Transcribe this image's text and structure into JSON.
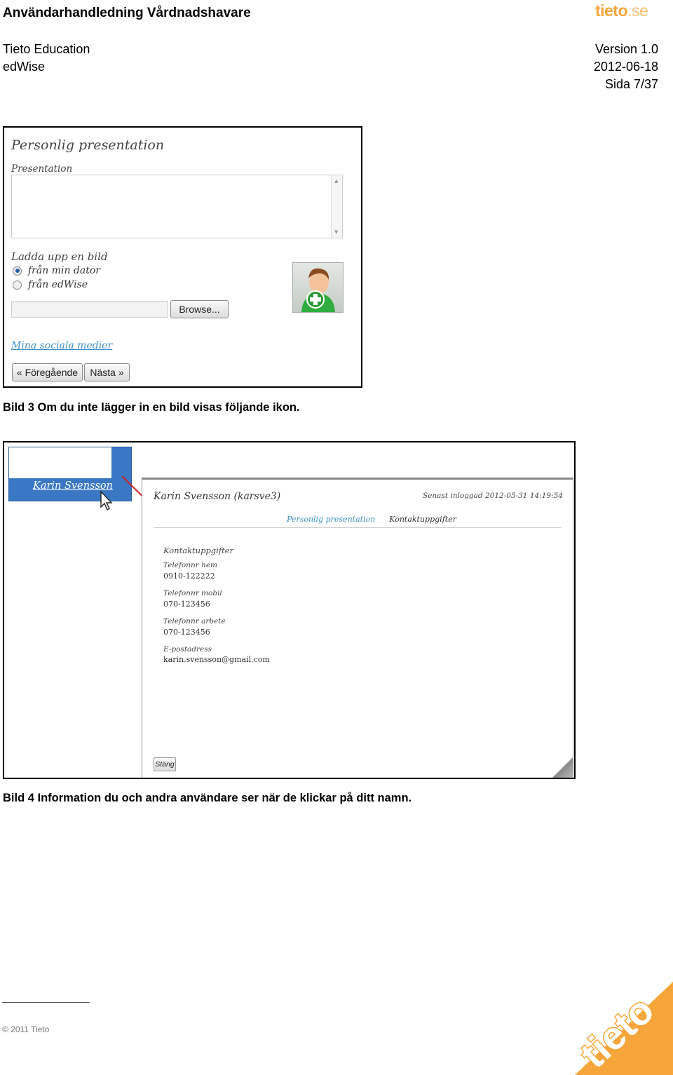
{
  "header": {
    "title": "Användarhandledning Vårdnadshavare",
    "logo_main": "tieto",
    "logo_domain": ".se",
    "company": "Tieto Education",
    "product": "edWise",
    "version": "Version 1.0",
    "date": "2012-06-18",
    "page": "Sida 7/37"
  },
  "figure1": {
    "heading": "Personlig presentation",
    "presentation_label": "Presentation",
    "presentation_value": "",
    "upload_label": "Ladda upp en bild",
    "radio_options": [
      "från min dator",
      "från edWise"
    ],
    "radio_selected": "från min dator",
    "file_value": "",
    "browse_label": "Browse...",
    "avatar_icon": "add-user-icon",
    "social_link": "Mina sociala medier",
    "prev_label": "« Föregående",
    "next_label": "Nästa »"
  },
  "caption1": "Bild 3 Om du inte lägger in en bild visas följande ikon.",
  "figure2": {
    "name_link": "Karin Svensson",
    "cursor_icon": "mouse-cursor-icon",
    "arrow_color": "#d02020",
    "profile_name": "Karin Svensson (karsve3)",
    "last_login": "Senast inloggad 2012-05-31 14:19:54",
    "tabs": [
      "Personlig presentation",
      "Kontaktuppgifter"
    ],
    "active_tab": "Kontaktuppgifter",
    "section_title": "Kontaktuppgifter",
    "fields": [
      {
        "label": "Telefonnr hem",
        "value": "0910-122222"
      },
      {
        "label": "Telefonnr mobil",
        "value": "070-123456"
      },
      {
        "label": "Telefonnr arbete",
        "value": "070-123456"
      },
      {
        "label": "E-postadress",
        "value": "karin.svensson@gmail.com"
      }
    ],
    "close_label": "Stäng"
  },
  "caption2": "Bild 4 Information du och andra användare ser när de klickar på ditt namn.",
  "footer": {
    "copyright": "© 2011 Tieto",
    "logo_text": "tieto",
    "brand_color": "#f5a53a"
  }
}
